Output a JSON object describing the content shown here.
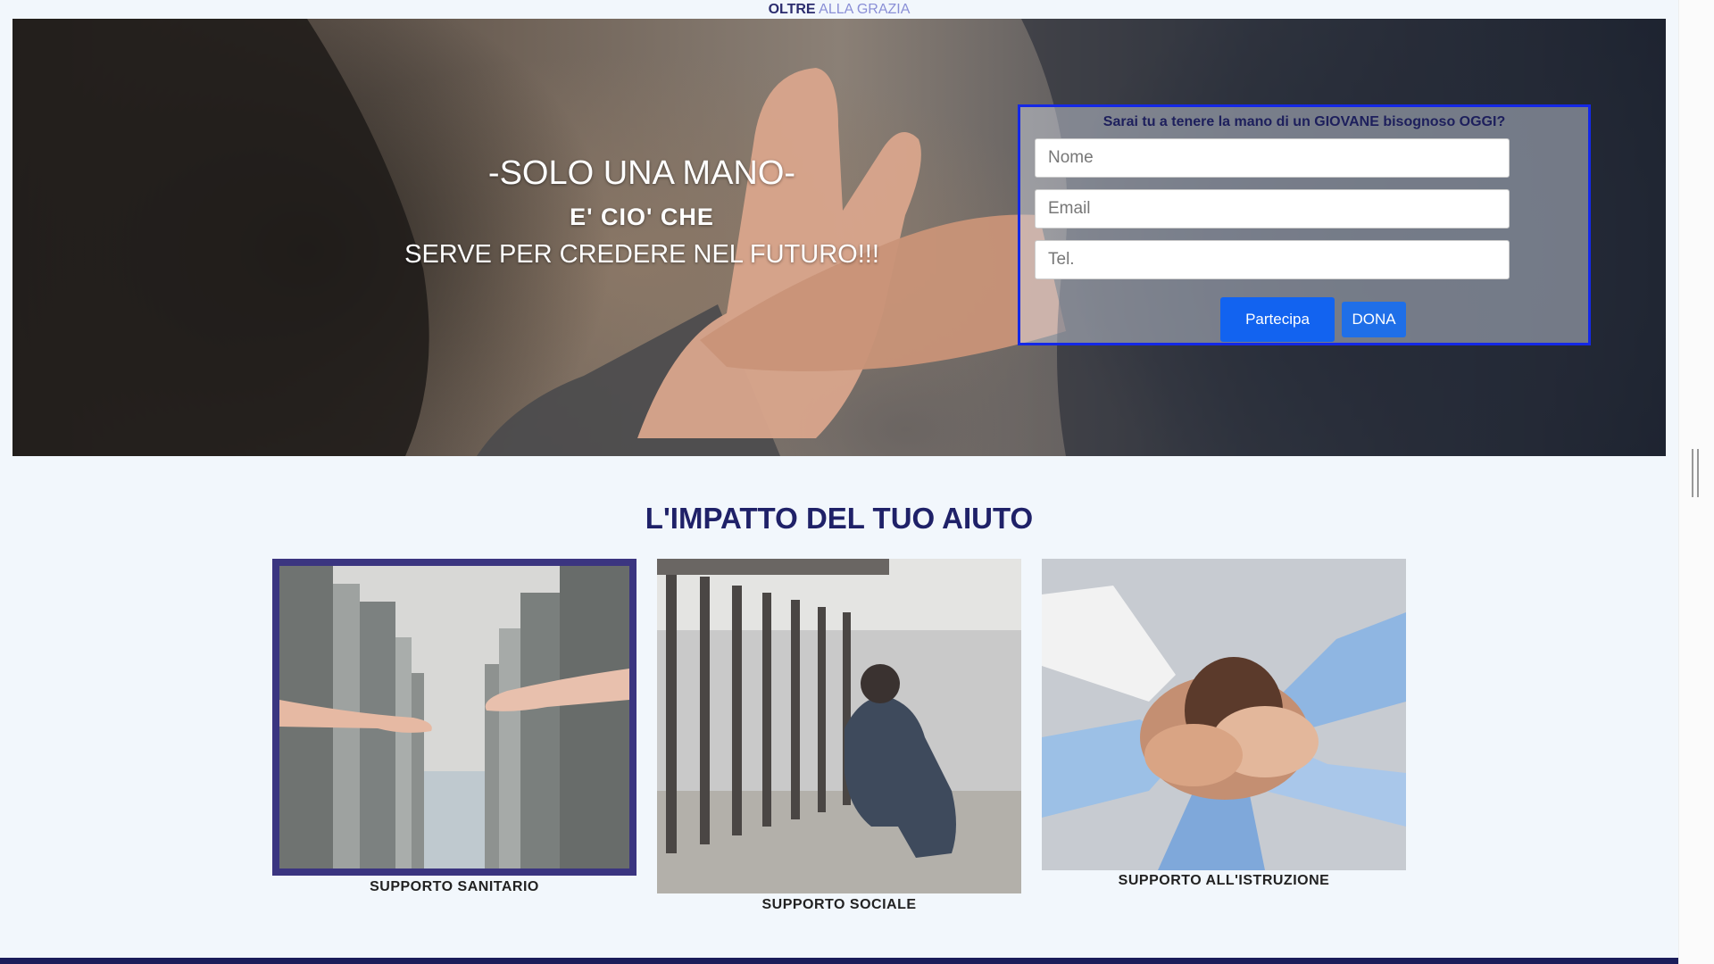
{
  "brand": {
    "part1": "OLTRE",
    "part2": "ALLA GRAZIA"
  },
  "hero": {
    "title": "-SOLO UNA MANO-",
    "subtitle_bold": "E'  CIO' CHE",
    "subtitle": "SERVE PER CREDERE NEL FUTURO!!!"
  },
  "form": {
    "question": "Sarai tu a tenere la mano di un GIOVANE bisognoso OGGI?",
    "name_placeholder": "Nome",
    "email_placeholder": "Email",
    "phone_placeholder": "Tel.",
    "submit_label": "Partecipa",
    "donate_label": "DONA"
  },
  "impact": {
    "title": "L'IMPATTO DEL TUO AIUTO",
    "cards": [
      {
        "label": "SUPPORTO SANITARIO"
      },
      {
        "label": "SUPPORTO SOCIALE"
      },
      {
        "label": "SUPPORTO ALL'ISTRUZIONE"
      }
    ]
  },
  "colors": {
    "page_bg": "#f2f7fc",
    "brand_dark": "#2c2d6e",
    "form_border": "#1428e6",
    "button_blue": "#1263f0",
    "footer_bar": "#1b1d5a"
  }
}
